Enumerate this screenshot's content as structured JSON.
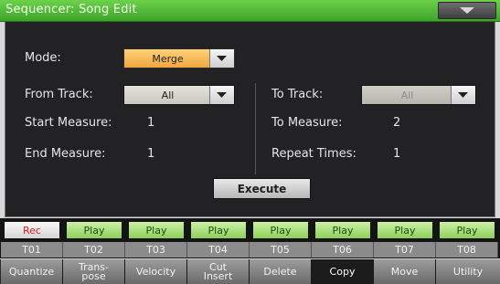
{
  "window": {
    "title": "Sequencer: Song Edit"
  },
  "form": {
    "mode_label": "Mode:",
    "mode_value": "Merge",
    "from_track_label": "From Track:",
    "from_track_value": "All",
    "to_track_label": "To Track:",
    "to_track_value": "All",
    "start_measure_label": "Start Measure:",
    "start_measure_value": "1",
    "end_measure_label": "End Measure:",
    "end_measure_value": "1",
    "to_measure_label": "To Measure:",
    "to_measure_value": "2",
    "repeat_times_label": "Repeat Times:",
    "repeat_times_value": "1",
    "execute_label": "Execute"
  },
  "tracks": [
    {
      "name": "T01",
      "state": "Rec"
    },
    {
      "name": "T02",
      "state": "Play"
    },
    {
      "name": "T03",
      "state": "Play"
    },
    {
      "name": "T04",
      "state": "Play"
    },
    {
      "name": "T05",
      "state": "Play"
    },
    {
      "name": "T06",
      "state": "Play"
    },
    {
      "name": "T07",
      "state": "Play"
    },
    {
      "name": "T08",
      "state": "Play"
    }
  ],
  "tabs": [
    {
      "label": "Quantize"
    },
    {
      "label": "Trans-\npose"
    },
    {
      "label": "Velocity"
    },
    {
      "label": "Cut\nInsert"
    },
    {
      "label": "Delete"
    },
    {
      "label": "Copy",
      "active": true
    },
    {
      "label": "Move"
    },
    {
      "label": "Utility"
    }
  ],
  "colors": {
    "title_bar": "#4cb834",
    "mode_dropdown": "#f5b455",
    "rec": "#d02020",
    "play": "#a8e07a"
  }
}
